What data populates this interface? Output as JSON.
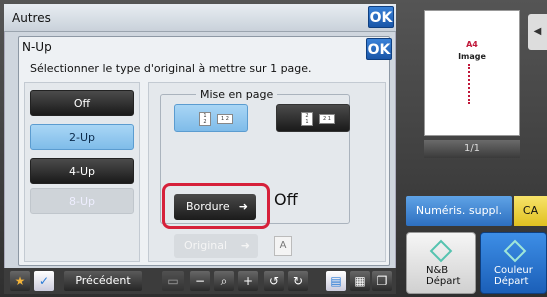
{
  "outer_dialog": {
    "title": "Autres",
    "ok_label": "OK"
  },
  "inner_dialog": {
    "title": "N-Up",
    "ok_label": "OK",
    "instruction": "Sélectionner le type d'original à mettre sur 1 page."
  },
  "nup_options": [
    {
      "label": "Off",
      "state": "normal"
    },
    {
      "label": "2-Up",
      "state": "selected"
    },
    {
      "label": "4-Up",
      "state": "normal"
    },
    {
      "label": "8-Up",
      "state": "disabled"
    }
  ],
  "layout": {
    "label": "Mise en page",
    "option1_pages": [
      "1",
      "2"
    ],
    "option2_pages": [
      "2",
      "1"
    ]
  },
  "border": {
    "button_label": "Bordure",
    "value": "Off"
  },
  "original": {
    "button_label": "Original",
    "a_label": "A"
  },
  "toolbar": {
    "previous_label": "Précédent"
  },
  "preview": {
    "paper": "A4",
    "caption": "Image",
    "page_counter": "1/1"
  },
  "actions": {
    "extra_scan_label": "Numéris. suppl.",
    "ca_label": "CA",
    "bw_label": "N&B",
    "bw_start": "Départ",
    "color_label": "Couleur",
    "color_start": "Départ"
  },
  "colors": {
    "accent_blue": "#1a56a8",
    "selected": "#7fbce9",
    "highlight_ring": "#d6203a",
    "ca_yellow": "#e0c020"
  }
}
